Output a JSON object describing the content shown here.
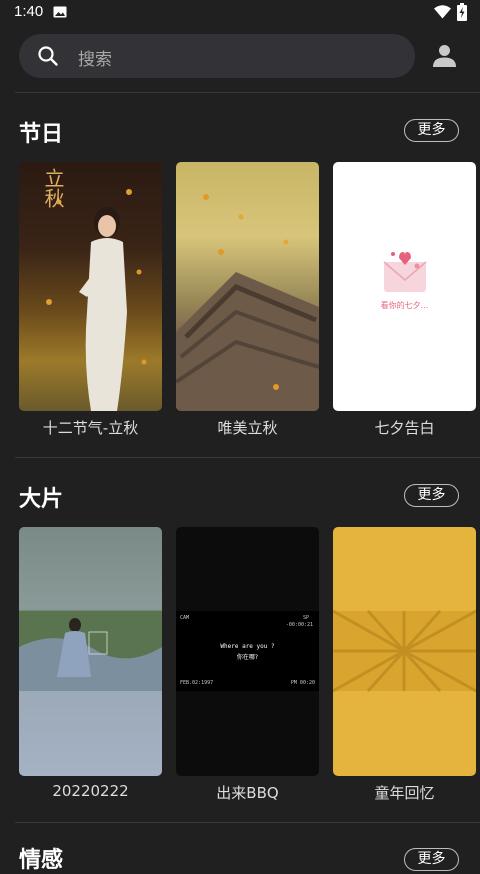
{
  "status_bar": {
    "time": "1:40"
  },
  "search": {
    "placeholder": "搜索"
  },
  "sections": [
    {
      "title": "节日",
      "more_label": "更多",
      "cards": [
        {
          "label": "十二节气-立秋",
          "overlay_text": "立秋"
        },
        {
          "label": "唯美立秋"
        },
        {
          "label": "七夕告白",
          "overlay_text": "看你的七夕..."
        }
      ]
    },
    {
      "title": "大片",
      "more_label": "更多",
      "cards": [
        {
          "label": "20220222"
        },
        {
          "label": "出来BBQ",
          "overlay_text": "Where are you ?",
          "overlay_sub": "你在哪?",
          "cam": "CAM",
          "sp": "SP",
          "counter": "-00:00:21",
          "date": "FEB.02:1997",
          "pm": "PM 00:20"
        },
        {
          "label": "童年回忆"
        }
      ]
    },
    {
      "title": "情感",
      "more_label": "更多"
    }
  ],
  "colors": {
    "background": "#202020",
    "search_bg": "#333337",
    "accent": "#ffffff"
  }
}
